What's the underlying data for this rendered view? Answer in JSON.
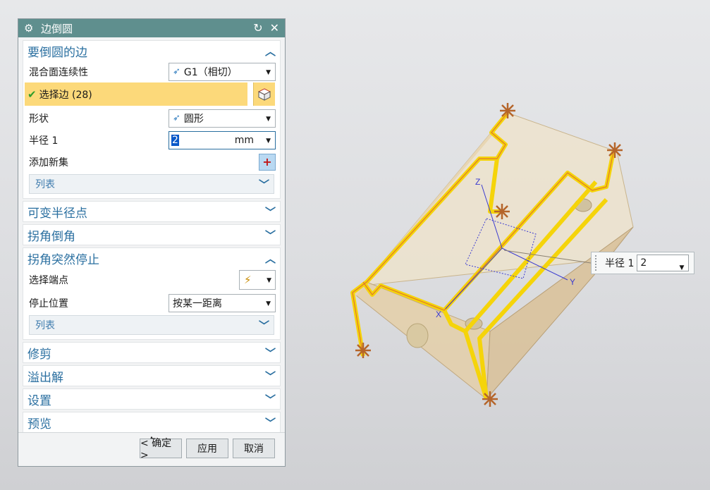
{
  "dialog": {
    "title": "边倒圆",
    "sections": {
      "edges": {
        "title": "要倒圆的边",
        "continuity_label": "混合面连续性",
        "continuity_value": "G1（相切）",
        "select_label": "选择边 (28)",
        "shape_label": "形状",
        "shape_value": "圆形",
        "radius_label": "半径 1",
        "radius_value": "2",
        "radius_unit": "mm",
        "add_set_label": "添加新集",
        "list_label": "列表"
      },
      "variable_radius": {
        "title": "可变半径点"
      },
      "corner_chamfer": {
        "title": "拐角倒角"
      },
      "corner_stop": {
        "title": "拐角突然停止",
        "endpoint_label": "选择端点",
        "stop_label": "停止位置",
        "stop_value": "按某一距离",
        "list_label": "列表"
      },
      "trim": {
        "title": "修剪"
      },
      "overflow": {
        "title": "溢出解"
      },
      "settings": {
        "title": "设置"
      },
      "preview": {
        "title": "预览"
      }
    },
    "buttons": {
      "ok": "< 确定 >",
      "apply": "应用",
      "cancel": "取消"
    }
  },
  "viewport": {
    "radius_tip_label": "半径 1",
    "radius_tip_value": "2",
    "axis_x": "X",
    "axis_y": "Y",
    "axis_z": "Z"
  },
  "colors": {
    "titlebar": "#5f8f8e",
    "section_title": "#2a6fa0",
    "selected_row": "#fcd97a",
    "edge_highlight": "#f5d40a",
    "part_body": "#e9d7b6"
  }
}
